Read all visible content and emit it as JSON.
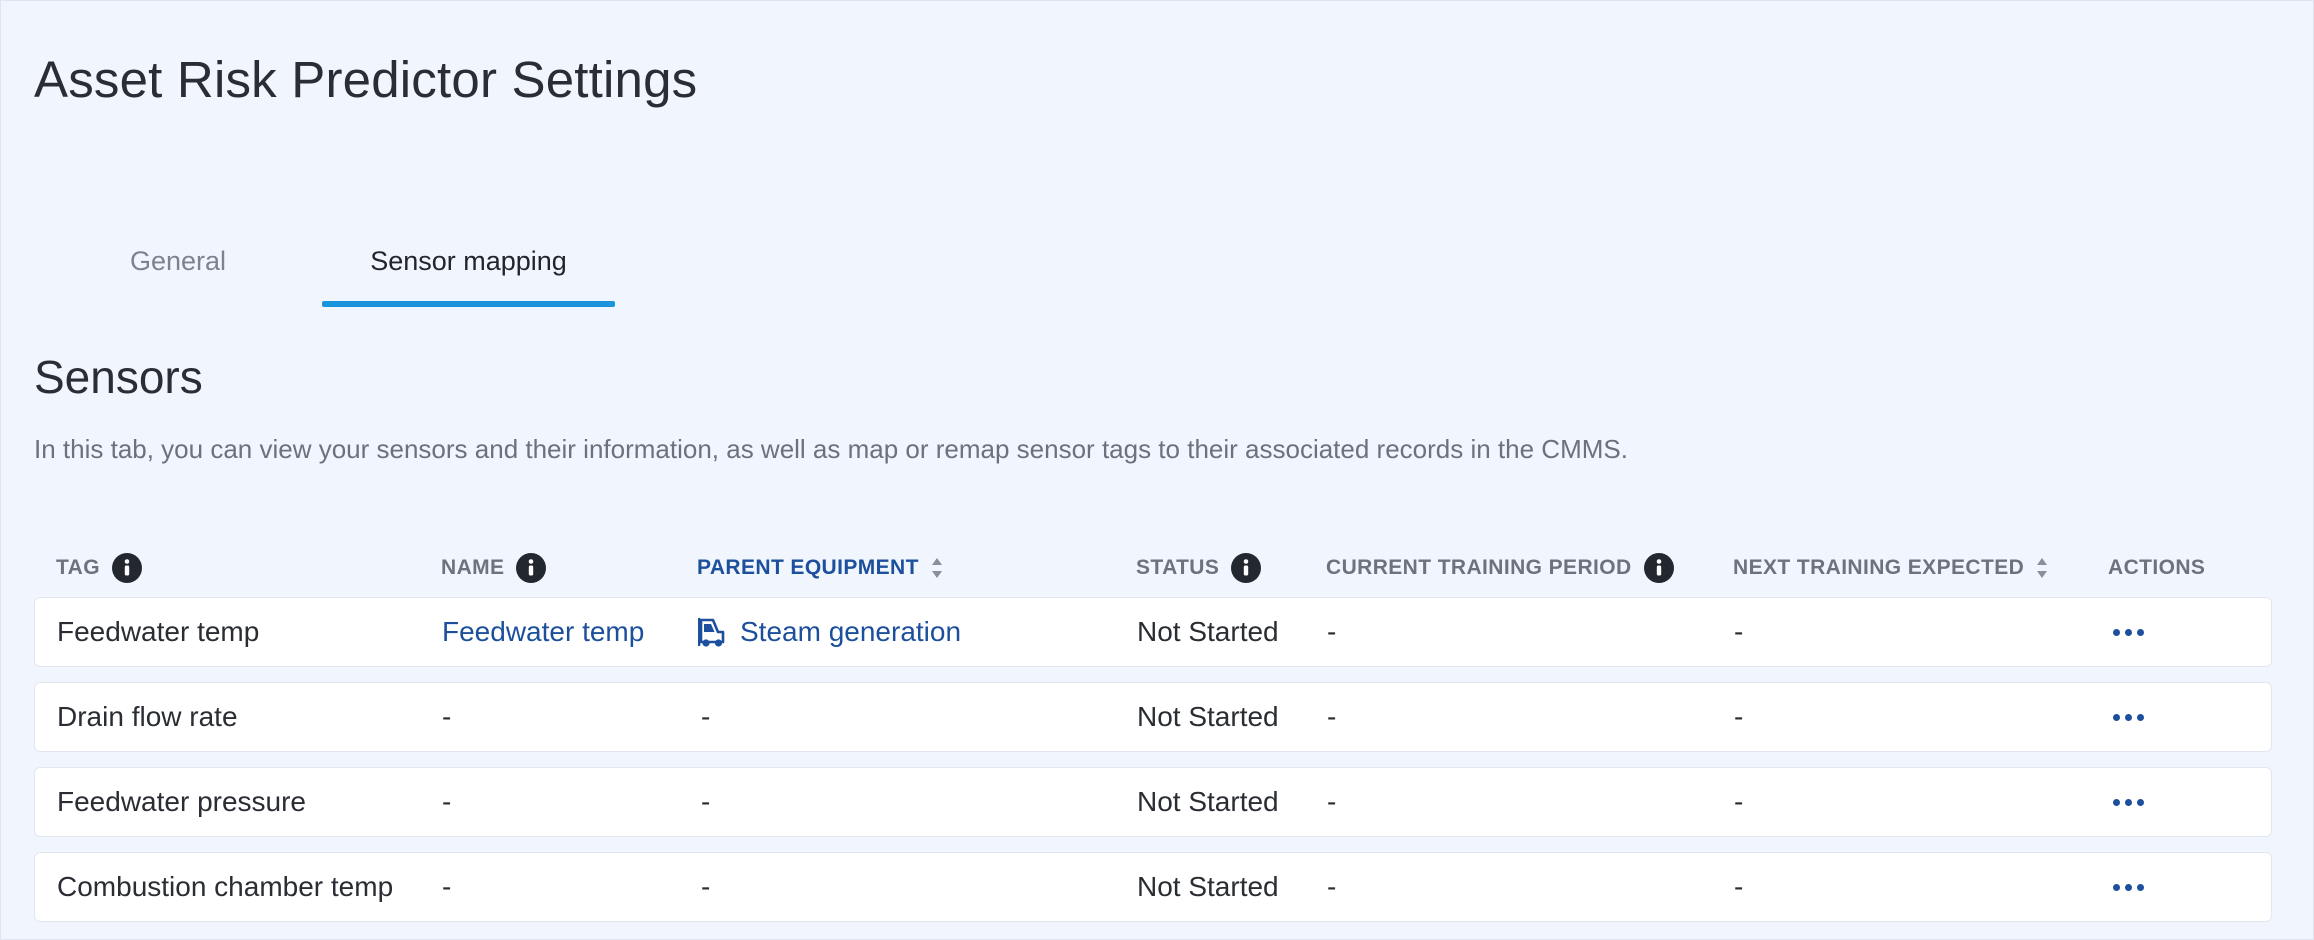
{
  "page": {
    "title": "Asset Risk Predictor Settings"
  },
  "tabs": [
    {
      "label": "General",
      "active": false
    },
    {
      "label": "Sensor mapping",
      "active": true
    }
  ],
  "section": {
    "title": "Sensors",
    "description": "In this tab, you can view your sensors and their information, as well as map or remap sensor tags to their associated records in the CMMS."
  },
  "table": {
    "columns": {
      "tag": "TAG",
      "name": "NAME",
      "parent_equipment": "PARENT EQUIPMENT",
      "status": "STATUS",
      "current_training_period": "CURRENT TRAINING PERIOD",
      "next_training_expected": "NEXT TRAINING EXPECTED",
      "actions": "ACTIONS"
    },
    "rows": [
      {
        "tag": "Feedwater temp",
        "name": "Feedwater temp",
        "parent_equipment": "Steam generation",
        "status": "Not Started",
        "current_training_period": "-",
        "next_training_expected": "-"
      },
      {
        "tag": "Drain flow rate",
        "name": "-",
        "parent_equipment": "-",
        "status": "Not Started",
        "current_training_period": "-",
        "next_training_expected": "-"
      },
      {
        "tag": "Feedwater pressure",
        "name": "-",
        "parent_equipment": "-",
        "status": "Not Started",
        "current_training_period": "-",
        "next_training_expected": "-"
      },
      {
        "tag": "Combustion chamber temp",
        "name": "-",
        "parent_equipment": "-",
        "status": "Not Started",
        "current_training_period": "-",
        "next_training_expected": "-"
      }
    ]
  },
  "icons": {
    "info": "info-icon",
    "sort": "sort-icon",
    "equipment": "forklift-icon",
    "actions": "more-horizontal-icon"
  },
  "colors": {
    "background": "#f0f5fe",
    "accent": "#1a94dd",
    "link": "#1c4f9c"
  }
}
